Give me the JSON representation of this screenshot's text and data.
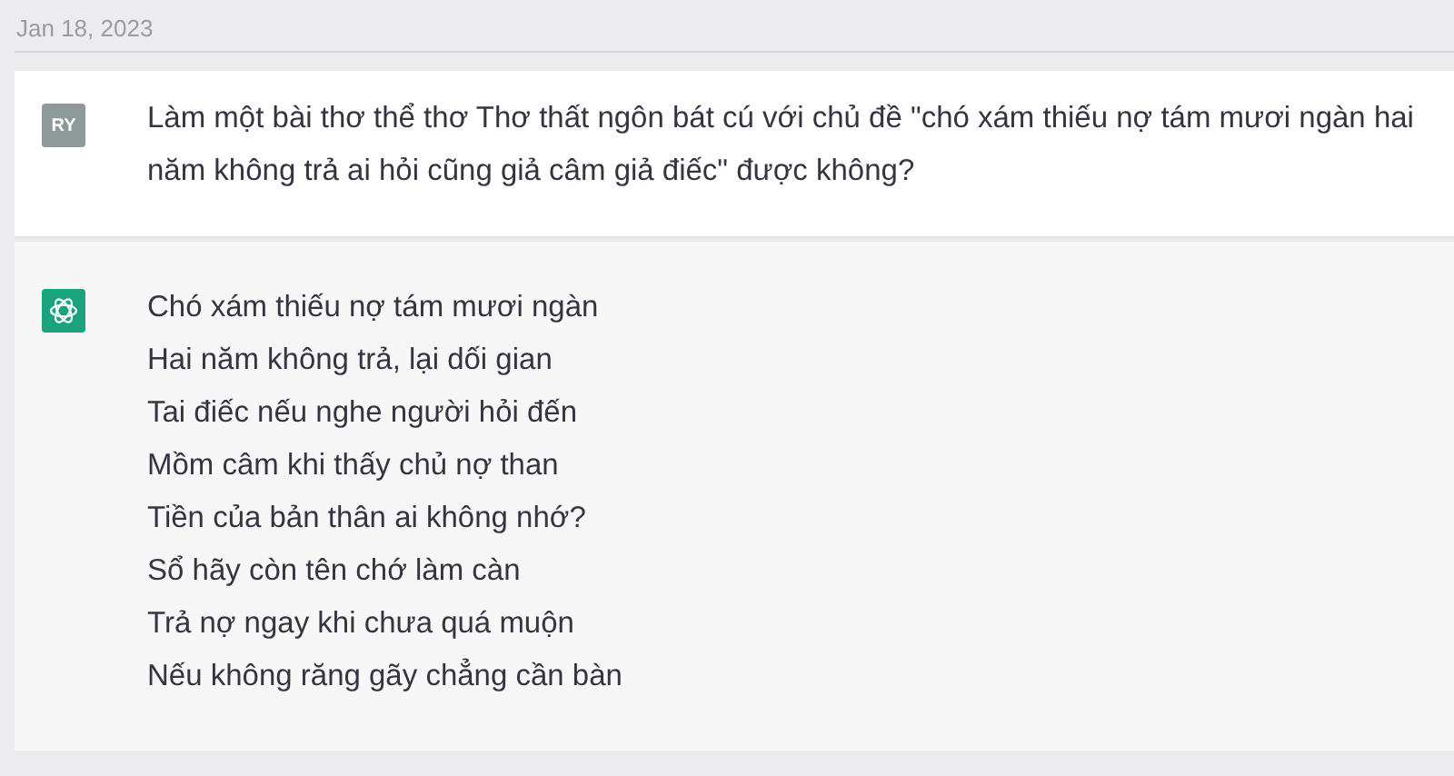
{
  "date": "Jan 18, 2023",
  "messages": [
    {
      "kind": "user",
      "avatar": "RY",
      "text": "Làm một bài thơ thể thơ Thơ thất ngôn bát cú với chủ đề \"chó xám thiếu nợ tám mươi ngàn hai năm không trả ai hỏi cũng giả câm giả điếc\" được không?"
    },
    {
      "kind": "assistant",
      "lines": [
        "Chó xám thiếu nợ tám mươi ngàn",
        "Hai năm không trả, lại dối gian",
        "Tai điếc nếu nghe người hỏi đến",
        "Mồm câm khi thấy chủ nợ than",
        "Tiền của bản thân ai không nhớ?",
        "Sổ hãy còn tên chớ làm càn",
        "Trả nợ ngay khi chưa quá muộn",
        "Nếu không răng gãy chẳng cần bàn"
      ]
    }
  ]
}
